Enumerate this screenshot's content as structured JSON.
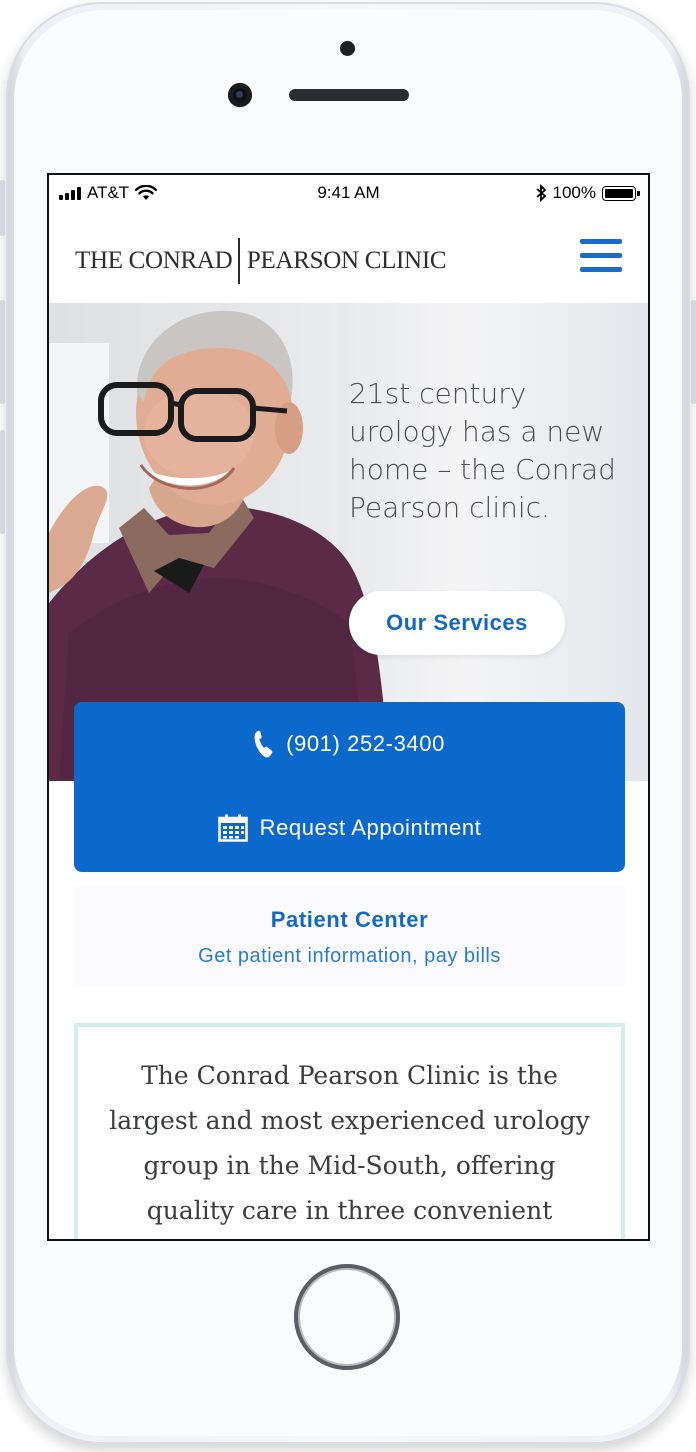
{
  "status_bar": {
    "carrier": "AT&T",
    "time": "9:41 AM",
    "battery": "100%"
  },
  "header": {
    "logo_left": "THE CONRAD",
    "logo_right": "PEARSON CLINIC",
    "menu_icon": "hamburger-menu-icon"
  },
  "hero": {
    "headline": "21st century urology has a new home – the Conrad Pearson clinic.",
    "services_button": "Our Services"
  },
  "cta": {
    "phone": "(901) 252-3400",
    "appointment": "Request Appointment",
    "phone_icon": "phone-icon",
    "calendar_icon": "calendar-icon"
  },
  "patient_center": {
    "title": "Patient Center",
    "subtitle": "Get patient information, pay bills"
  },
  "intro": {
    "text": "The Conrad Pearson Clinic is the largest and most experienced urology group in the Mid-South, offering quality care in three convenient"
  },
  "colors": {
    "brand_blue": "#0c69cc",
    "link_blue": "#1468c2",
    "intro_border": "#d2efec"
  }
}
